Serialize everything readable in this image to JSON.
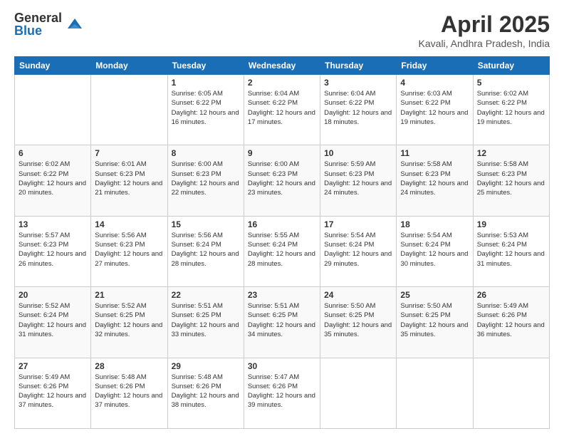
{
  "logo": {
    "general": "General",
    "blue": "Blue"
  },
  "title": "April 2025",
  "subtitle": "Kavali, Andhra Pradesh, India",
  "days_of_week": [
    "Sunday",
    "Monday",
    "Tuesday",
    "Wednesday",
    "Thursday",
    "Friday",
    "Saturday"
  ],
  "weeks": [
    [
      {
        "day": "",
        "info": ""
      },
      {
        "day": "",
        "info": ""
      },
      {
        "day": "1",
        "info": "Sunrise: 6:05 AM\nSunset: 6:22 PM\nDaylight: 12 hours and 16 minutes."
      },
      {
        "day": "2",
        "info": "Sunrise: 6:04 AM\nSunset: 6:22 PM\nDaylight: 12 hours and 17 minutes."
      },
      {
        "day": "3",
        "info": "Sunrise: 6:04 AM\nSunset: 6:22 PM\nDaylight: 12 hours and 18 minutes."
      },
      {
        "day": "4",
        "info": "Sunrise: 6:03 AM\nSunset: 6:22 PM\nDaylight: 12 hours and 19 minutes."
      },
      {
        "day": "5",
        "info": "Sunrise: 6:02 AM\nSunset: 6:22 PM\nDaylight: 12 hours and 19 minutes."
      }
    ],
    [
      {
        "day": "6",
        "info": "Sunrise: 6:02 AM\nSunset: 6:22 PM\nDaylight: 12 hours and 20 minutes."
      },
      {
        "day": "7",
        "info": "Sunrise: 6:01 AM\nSunset: 6:23 PM\nDaylight: 12 hours and 21 minutes."
      },
      {
        "day": "8",
        "info": "Sunrise: 6:00 AM\nSunset: 6:23 PM\nDaylight: 12 hours and 22 minutes."
      },
      {
        "day": "9",
        "info": "Sunrise: 6:00 AM\nSunset: 6:23 PM\nDaylight: 12 hours and 23 minutes."
      },
      {
        "day": "10",
        "info": "Sunrise: 5:59 AM\nSunset: 6:23 PM\nDaylight: 12 hours and 24 minutes."
      },
      {
        "day": "11",
        "info": "Sunrise: 5:58 AM\nSunset: 6:23 PM\nDaylight: 12 hours and 24 minutes."
      },
      {
        "day": "12",
        "info": "Sunrise: 5:58 AM\nSunset: 6:23 PM\nDaylight: 12 hours and 25 minutes."
      }
    ],
    [
      {
        "day": "13",
        "info": "Sunrise: 5:57 AM\nSunset: 6:23 PM\nDaylight: 12 hours and 26 minutes."
      },
      {
        "day": "14",
        "info": "Sunrise: 5:56 AM\nSunset: 6:23 PM\nDaylight: 12 hours and 27 minutes."
      },
      {
        "day": "15",
        "info": "Sunrise: 5:56 AM\nSunset: 6:24 PM\nDaylight: 12 hours and 28 minutes."
      },
      {
        "day": "16",
        "info": "Sunrise: 5:55 AM\nSunset: 6:24 PM\nDaylight: 12 hours and 28 minutes."
      },
      {
        "day": "17",
        "info": "Sunrise: 5:54 AM\nSunset: 6:24 PM\nDaylight: 12 hours and 29 minutes."
      },
      {
        "day": "18",
        "info": "Sunrise: 5:54 AM\nSunset: 6:24 PM\nDaylight: 12 hours and 30 minutes."
      },
      {
        "day": "19",
        "info": "Sunrise: 5:53 AM\nSunset: 6:24 PM\nDaylight: 12 hours and 31 minutes."
      }
    ],
    [
      {
        "day": "20",
        "info": "Sunrise: 5:52 AM\nSunset: 6:24 PM\nDaylight: 12 hours and 31 minutes."
      },
      {
        "day": "21",
        "info": "Sunrise: 5:52 AM\nSunset: 6:25 PM\nDaylight: 12 hours and 32 minutes."
      },
      {
        "day": "22",
        "info": "Sunrise: 5:51 AM\nSunset: 6:25 PM\nDaylight: 12 hours and 33 minutes."
      },
      {
        "day": "23",
        "info": "Sunrise: 5:51 AM\nSunset: 6:25 PM\nDaylight: 12 hours and 34 minutes."
      },
      {
        "day": "24",
        "info": "Sunrise: 5:50 AM\nSunset: 6:25 PM\nDaylight: 12 hours and 35 minutes."
      },
      {
        "day": "25",
        "info": "Sunrise: 5:50 AM\nSunset: 6:25 PM\nDaylight: 12 hours and 35 minutes."
      },
      {
        "day": "26",
        "info": "Sunrise: 5:49 AM\nSunset: 6:26 PM\nDaylight: 12 hours and 36 minutes."
      }
    ],
    [
      {
        "day": "27",
        "info": "Sunrise: 5:49 AM\nSunset: 6:26 PM\nDaylight: 12 hours and 37 minutes."
      },
      {
        "day": "28",
        "info": "Sunrise: 5:48 AM\nSunset: 6:26 PM\nDaylight: 12 hours and 37 minutes."
      },
      {
        "day": "29",
        "info": "Sunrise: 5:48 AM\nSunset: 6:26 PM\nDaylight: 12 hours and 38 minutes."
      },
      {
        "day": "30",
        "info": "Sunrise: 5:47 AM\nSunset: 6:26 PM\nDaylight: 12 hours and 39 minutes."
      },
      {
        "day": "",
        "info": ""
      },
      {
        "day": "",
        "info": ""
      },
      {
        "day": "",
        "info": ""
      }
    ]
  ]
}
